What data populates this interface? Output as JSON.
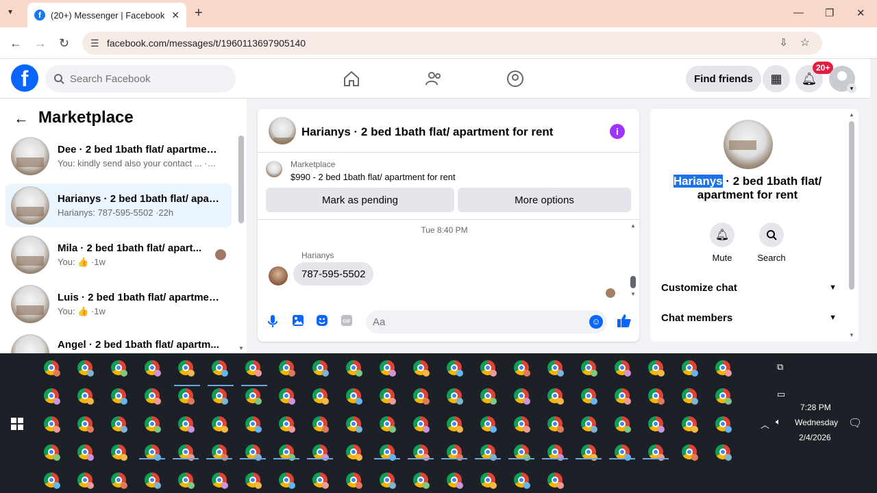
{
  "browser": {
    "tab_title": "(20+) Messenger | Facebook",
    "url": "facebook.com/messages/t/1960113697905140"
  },
  "fb": {
    "search_placeholder": "Search Facebook",
    "find_friends": "Find friends",
    "notif_badge": "20+"
  },
  "left": {
    "title": "Marketplace",
    "conversations": [
      {
        "name": "Dee · 2 bed 1bath flat/ apartmen...",
        "preview": "You: kindly send also your contact ... ·1m",
        "bold": true
      },
      {
        "name": "Harianys · 2 bed 1bath flat/ apar...",
        "preview": "Harianys: 787-595-5502 ·22h",
        "bold": true
      },
      {
        "name": "Mila · 2 bed 1bath flat/ apart...",
        "preview": "You: 👍 ·1w",
        "bold": true
      },
      {
        "name": "Luis · 2 bed 1bath flat/ apartmen...",
        "preview": "You: 👍 ·1w",
        "bold": true
      },
      {
        "name": "Angel · 2 bed 1bath flat/ apartm...",
        "preview": "",
        "bold": true
      }
    ]
  },
  "chat": {
    "title": "Harianys · 2 bed 1bath flat/ apartment for rent",
    "marketplace_label": "Marketplace",
    "listing": "$990 - 2 bed 1bath flat/ apartment for rent",
    "btn_pending": "Mark as pending",
    "btn_more": "More options",
    "timestamp": "Tue 8:40 PM",
    "sender": "Harianys",
    "message": "787-595-5502",
    "composer_placeholder": "Aa"
  },
  "right": {
    "name_highlight": "Harianys",
    "title_rest": " · 2 bed 1bath flat/ apartment for rent",
    "mute": "Mute",
    "search": "Search",
    "customize": "Customize chat",
    "members": "Chat members"
  },
  "tray": {
    "time": "7:28 PM",
    "day": "Wednesday",
    "date": "2/4/2026"
  },
  "colors": {
    "accent": "#0866ff",
    "tab_strip": "#f9d8cc",
    "active_conv": "#ebf5ff",
    "taskbar": "#1c2127"
  },
  "icons": [
    "facebook-logo-icon",
    "search-icon",
    "home-icon",
    "friends-icon",
    "groups-icon",
    "apps-grid-icon",
    "bell-icon",
    "info-icon",
    "mic-icon",
    "image-icon",
    "sticker-icon",
    "gif-icon",
    "emoji-icon",
    "like-icon",
    "mute-icon",
    "chevron-down-icon",
    "windows-start-icon",
    "chrome-icon"
  ]
}
